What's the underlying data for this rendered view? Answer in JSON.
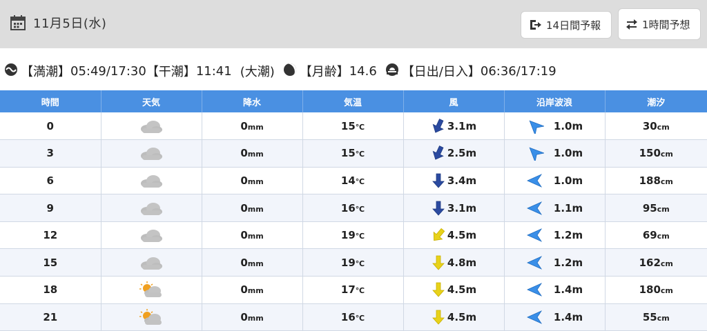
{
  "header": {
    "date": "11月5日(水)",
    "btn_14day": "14日間予報",
    "btn_1hour": "1時間予想"
  },
  "tide_info": {
    "high_label": "【満潮】",
    "high_value": "05:49/17:30",
    "low_label": "【干潮】",
    "low_value": "11:41",
    "tide_type": "(大潮)",
    "moon_label": "【月齢】",
    "moon_value": "14.6",
    "sun_label": "【日出/日入】",
    "sun_value": "06:36/17:19"
  },
  "table": {
    "headers": [
      "時間",
      "天気",
      "降水",
      "気温",
      "風",
      "沿岸波浪",
      "潮汐"
    ],
    "rows": [
      {
        "time": "0",
        "weather": "cloudy-icon",
        "rain": "0",
        "rain_unit": "mm",
        "temp": "15",
        "temp_unit": "℃",
        "wind": "3.1m",
        "wind_dir": "south-southwest",
        "wind_color": "#2b4aa0",
        "wave": "1.0m",
        "wave_dir": "northwest",
        "tide": "30",
        "tide_unit": "cm"
      },
      {
        "time": "3",
        "weather": "cloudy-icon",
        "rain": "0",
        "rain_unit": "mm",
        "temp": "15",
        "temp_unit": "℃",
        "wind": "2.5m",
        "wind_dir": "south-southwest",
        "wind_color": "#2b4aa0",
        "wave": "1.0m",
        "wave_dir": "northwest",
        "tide": "150",
        "tide_unit": "cm"
      },
      {
        "time": "6",
        "weather": "cloudy-icon",
        "rain": "0",
        "rain_unit": "mm",
        "temp": "14",
        "temp_unit": "℃",
        "wind": "3.4m",
        "wind_dir": "south",
        "wind_color": "#2b4aa0",
        "wave": "1.0m",
        "wave_dir": "west",
        "tide": "188",
        "tide_unit": "cm"
      },
      {
        "time": "9",
        "weather": "cloudy-icon",
        "rain": "0",
        "rain_unit": "mm",
        "temp": "16",
        "temp_unit": "℃",
        "wind": "3.1m",
        "wind_dir": "south",
        "wind_color": "#2b4aa0",
        "wave": "1.1m",
        "wave_dir": "west",
        "tide": "95",
        "tide_unit": "cm"
      },
      {
        "time": "12",
        "weather": "cloudy-icon",
        "rain": "0",
        "rain_unit": "mm",
        "temp": "19",
        "temp_unit": "℃",
        "wind": "4.5m",
        "wind_dir": "southwest",
        "wind_color": "#e8d21a",
        "wave": "1.2m",
        "wave_dir": "west",
        "tide": "69",
        "tide_unit": "cm"
      },
      {
        "time": "15",
        "weather": "cloudy-icon",
        "rain": "0",
        "rain_unit": "mm",
        "temp": "19",
        "temp_unit": "℃",
        "wind": "4.8m",
        "wind_dir": "south",
        "wind_color": "#e8d21a",
        "wave": "1.2m",
        "wave_dir": "west",
        "tide": "162",
        "tide_unit": "cm"
      },
      {
        "time": "18",
        "weather": "sun-cloud-icon",
        "rain": "0",
        "rain_unit": "mm",
        "temp": "17",
        "temp_unit": "℃",
        "wind": "4.5m",
        "wind_dir": "south",
        "wind_color": "#e8d21a",
        "wave": "1.4m",
        "wave_dir": "west",
        "tide": "180",
        "tide_unit": "cm"
      },
      {
        "time": "21",
        "weather": "sun-cloud-icon",
        "rain": "0",
        "rain_unit": "mm",
        "temp": "16",
        "temp_unit": "℃",
        "wind": "4.5m",
        "wind_dir": "south",
        "wind_color": "#e8d21a",
        "wave": "1.4m",
        "wave_dir": "west",
        "tide": "55",
        "tide_unit": "cm"
      }
    ]
  },
  "colors": {
    "header_blue": "#4a90e2",
    "wave_arrow": "#3a8fe8",
    "stripe": "#f2f5fb"
  }
}
